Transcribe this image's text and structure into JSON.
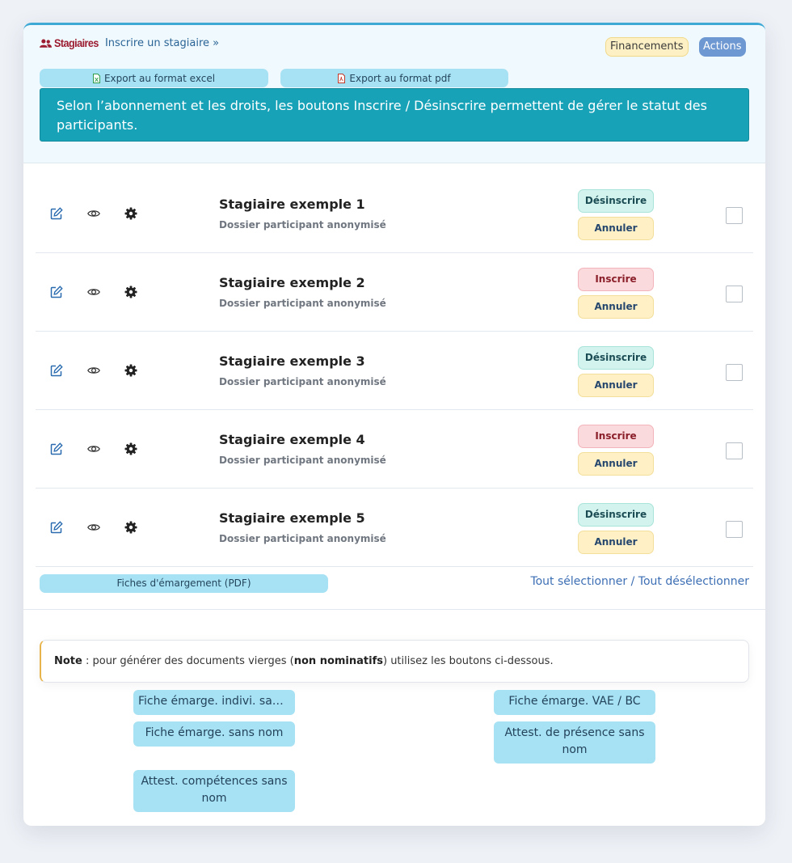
{
  "header": {
    "title": "Stagiaires",
    "subscribe_link": "Inscrire un stagiaire »",
    "financements_label": "Financements",
    "actions_label": "Actions",
    "export_excel_label": "Export au format excel",
    "export_pdf_label": "Export au format pdf",
    "info_banner": "Selon l’abonnement et les droits, les boutons Inscrire / Désinscrire permettent de gérer le statut des participants."
  },
  "participants": [
    {
      "name": "Stagiaire exemple 1",
      "subtitle": "Dossier participant anonymisé",
      "status_label": "Désinscrire",
      "status": "inscrit",
      "cancel_label": "Annuler",
      "checked": false
    },
    {
      "name": "Stagiaire exemple 2",
      "subtitle": "Dossier participant anonymisé",
      "status_label": "Inscrire",
      "status": "desinscrit",
      "cancel_label": "Annuler",
      "checked": false
    },
    {
      "name": "Stagiaire exemple 3",
      "subtitle": "Dossier participant anonymisé",
      "status_label": "Désinscrire",
      "status": "inscrit",
      "cancel_label": "Annuler",
      "checked": false
    },
    {
      "name": "Stagiaire exemple 4",
      "subtitle": "Dossier participant anonymisé",
      "status_label": "Inscrire",
      "status": "desinscrit",
      "cancel_label": "Annuler",
      "checked": false
    },
    {
      "name": "Stagiaire exemple 5",
      "subtitle": "Dossier participant anonymisé",
      "status_label": "Désinscrire",
      "status": "inscrit",
      "cancel_label": "Annuler",
      "checked": false
    }
  ],
  "row_icons": [
    "edit-icon",
    "eye-icon",
    "gear-icon"
  ],
  "footer": {
    "fiches_label": "Fiches d'émargement (PDF)",
    "select_all_label": "Tout sélectionner / Tout désélectionner"
  },
  "note": {
    "prefix_bold": "Note",
    "text_before": " : pour générer des documents vierges (",
    "bold_middle": "non nominatifs",
    "text_after": ") utilisez les boutons ci-dessous."
  },
  "blank_docs": {
    "left": [
      "Fiche émarge. indivi. sans nom",
      "Fiche émarge. sans nom",
      "Attest. compétences sans nom"
    ],
    "right": [
      "Fiche émarge. VAE / BC",
      "Attest. de présence sans nom"
    ]
  },
  "colors": {
    "title": "#9b1b30",
    "banner": "#17a2b8",
    "export_button": "#a7e1f4",
    "desinscrire": "#d3f3ee",
    "inscrire": "#fbdadd",
    "annuler": "#fff0c6",
    "actions": "#6d98d1"
  }
}
